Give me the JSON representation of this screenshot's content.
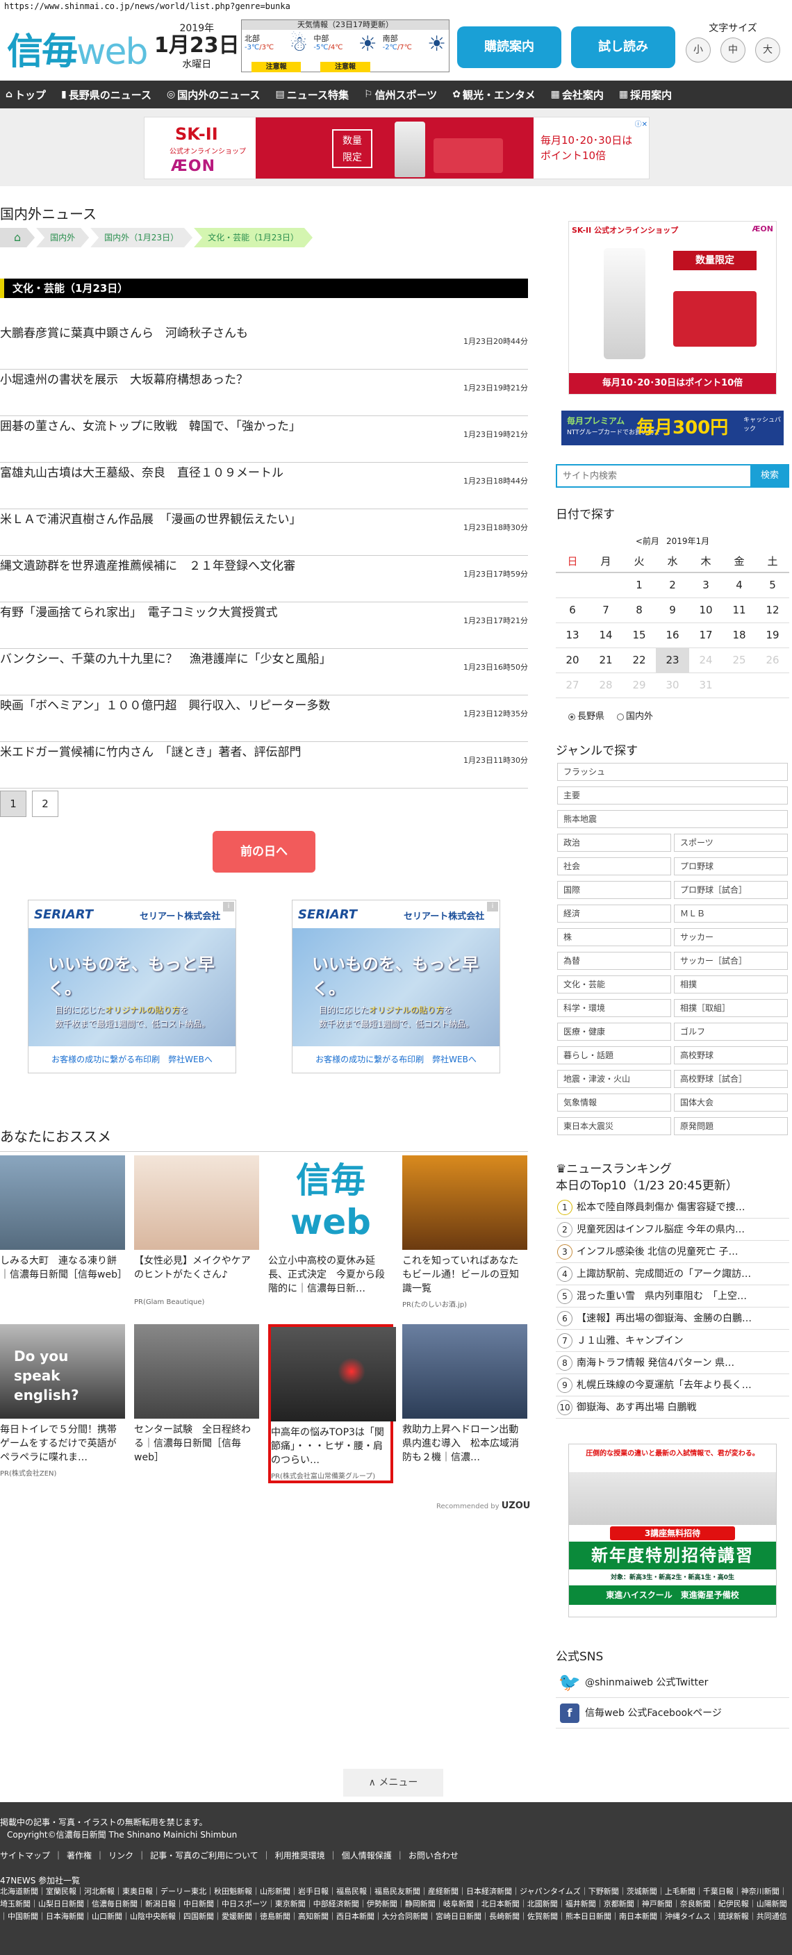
{
  "url": "https://www.shinmai.co.jp/news/world/list.php?genre=bunka",
  "header": {
    "logo_main": "信毎",
    "logo_web": "web",
    "year": "2019年",
    "monthday": "1月23日",
    "weekday": "水曜日",
    "weather": {
      "title": "天気情報（23日17時更新）",
      "regions": [
        {
          "name": "北部",
          "lo": "-3℃",
          "hi": "/3℃",
          "icon": "snow-cloud-icon",
          "glyph": "☃",
          "warning": "注意報"
        },
        {
          "name": "中部",
          "lo": "-5℃",
          "hi": "/4℃",
          "icon": "sun-icon",
          "glyph": "☀",
          "warning": "注意報"
        },
        {
          "name": "南部",
          "lo": "-2℃",
          "hi": "/7℃",
          "icon": "sun-icon",
          "glyph": "☀",
          "warning": ""
        }
      ]
    },
    "btn_subscribe": "購読案内",
    "btn_trial": "試し読み",
    "font_size_label": "文字サイズ",
    "font_sizes": [
      "小",
      "中",
      "大"
    ]
  },
  "nav": [
    {
      "icon": "home-icon",
      "glyph": "⌂",
      "label": "トップ"
    },
    {
      "icon": "pin-icon",
      "glyph": "▮",
      "label": "長野県のニュース"
    },
    {
      "icon": "globe-icon",
      "glyph": "◎",
      "label": "国内外のニュース"
    },
    {
      "icon": "doc-icon",
      "glyph": "▤",
      "label": "ニュース特集"
    },
    {
      "icon": "sports-icon",
      "glyph": "⚐",
      "label": "信州スポーツ"
    },
    {
      "icon": "tourism-icon",
      "glyph": "✿",
      "label": "観光・エンタメ"
    },
    {
      "icon": "company-icon",
      "glyph": "▦",
      "label": "会社案内"
    },
    {
      "icon": "recruit-icon",
      "glyph": "▦",
      "label": "採用案内"
    }
  ],
  "top_ad": {
    "brand": "SK-II",
    "sub": "公式オンラインショップ",
    "store": "ÆON",
    "badge": "数量\n限定",
    "right_line1": "毎月10･20･30日は",
    "right_line2": "ポイント10倍"
  },
  "main": {
    "section_title": "国内外ニュース",
    "breadcrumb": [
      "国内外",
      "国内外（1月23日）",
      "文化・芸能（1月23日）"
    ],
    "category": "文化・芸能（1月23日）",
    "news": [
      {
        "title": "大鵬春彦賞に葉真中顕さんら　河崎秋子さんも",
        "time": "1月23日20時44分"
      },
      {
        "title": "小堀遠州の書状を展示　大坂幕府構想あった？",
        "time": "1月23日19時21分"
      },
      {
        "title": "囲碁の菫さん、女流トップに敗戦　韓国で、「強かった」",
        "time": "1月23日19時21分"
      },
      {
        "title": "富雄丸山古墳は大王墓級、奈良　直径１０９メートル",
        "time": "1月23日18時44分"
      },
      {
        "title": "米ＬＡで浦沢直樹さん作品展　「漫画の世界観伝えたい」",
        "time": "1月23日18時30分"
      },
      {
        "title": "縄文遺跡群を世界遺産推薦候補に　２１年登録へ文化審",
        "time": "1月23日17時59分"
      },
      {
        "title": "有野「漫画捨てられ家出」　電子コミック大賞授賞式",
        "time": "1月23日17時21分"
      },
      {
        "title": "バンクシー、千葉の九十九里に？　漁港護岸に「少女と風船」",
        "time": "1月23日16時50分"
      },
      {
        "title": "映画「ボヘミアン」１００億円超　興行収入、リピーター多数",
        "time": "1月23日12時35分"
      },
      {
        "title": "米エドガー賞候補に竹内さん　「謎とき」著者、評伝部門",
        "time": "1月23日11時30分"
      }
    ],
    "pages": [
      "1",
      "2"
    ],
    "prev_day": "前の日へ",
    "seriart_ad": {
      "logo": "SERIART",
      "company": "セリアート株式会社",
      "headline": "いいものを、もっと早く。",
      "line1a": "目的に応じた",
      "line1b": "オリジナルの貼り方",
      "line1c": "を",
      "line2a": "数千枚まで最短",
      "line2b": "1週間で、低コスト納品。",
      "footer": "お客様の成功に繋がる布印刷　弊社WEBへ",
      "info": "i"
    },
    "recommend_title": "あなたにおススメ",
    "recommend": [
      {
        "caption": "しみる大町　連なる凍り餅｜信濃毎日新聞［信毎web］",
        "pr": ""
      },
      {
        "caption": "【女性必見】メイクやケアのヒントがたくさん♪",
        "pr": "PR(Glam Beautique)"
      },
      {
        "caption": "公立小中高校の夏休み延長、正式決定　今夏から段階的に｜信濃毎日新…",
        "pr": ""
      },
      {
        "caption": "これを知っていればあなたもビール通！ビールの豆知識一覧",
        "pr": "PR(たのしいお酒.jp)"
      },
      {
        "caption": "毎日トイレで５分間！携帯ゲームをするだけで英語がペラペラに喋れま…",
        "pr": "PR(株式会社ZEN)"
      },
      {
        "caption": "センター試験　全日程終わる｜信濃毎日新聞［信毎web］",
        "pr": ""
      },
      {
        "caption": "中高年の悩みTOP3は「関節痛」・・・ヒザ・腰・肩のつらい…",
        "pr": "PR(株式会社富山常備薬グループ)"
      },
      {
        "caption": "救助力上昇へドローン出動　県内進む導入　松本広域消防も２機｜信濃…",
        "pr": ""
      }
    ],
    "english_text": "Do you speak english?",
    "recommend_by": "Recommended by",
    "recommend_brand": "UZOU"
  },
  "side": {
    "skii_bar": "SK-II 公式オンラインショップ",
    "skii_store": "ÆON",
    "skii_limited": "数量限定",
    "skii_bottom": "毎月10･20･30日はポイント10倍",
    "ntt_l1": "毎月プレミアム",
    "ntt_l2": "NTTグループカードでお買い物で",
    "ntt_center": "毎月300円",
    "ntt_right": "キャッシュバック",
    "search_placeholder": "サイト内検索",
    "search_btn": "検索",
    "date_title": "日付で探す",
    "cal_prev": "<前月",
    "cal_ym": "2019年1月",
    "cal_head": [
      "日",
      "月",
      "火",
      "水",
      "木",
      "金",
      "土"
    ],
    "cal_rows": [
      [
        "",
        "",
        "1",
        "2",
        "3",
        "4",
        "5"
      ],
      [
        "6",
        "7",
        "8",
        "9",
        "10",
        "11",
        "12"
      ],
      [
        "13",
        "14",
        "15",
        "16",
        "17",
        "18",
        "19"
      ],
      [
        "20",
        "21",
        "22",
        "23",
        "24",
        "25",
        "26"
      ],
      [
        "27",
        "28",
        "29",
        "30",
        "31",
        "",
        ""
      ]
    ],
    "cal_radio": [
      "長野県",
      "国内外"
    ],
    "genre_title": "ジャンルで探す",
    "genre_full": [
      "フラッシュ",
      "主要",
      "熊本地震"
    ],
    "genre_pairs": [
      [
        "政治",
        "スポーツ"
      ],
      [
        "社会",
        "プロ野球"
      ],
      [
        "国際",
        "プロ野球［試合］"
      ],
      [
        "経済",
        "ＭＬＢ"
      ],
      [
        "株",
        "サッカー"
      ],
      [
        "為替",
        "サッカー［試合］"
      ],
      [
        "文化・芸能",
        "相撲"
      ],
      [
        "科学・環境",
        "相撲［取組］"
      ],
      [
        "医療・健康",
        "ゴルフ"
      ],
      [
        "暮らし・話題",
        "高校野球"
      ],
      [
        "地震・津波・火山",
        "高校野球［試合］"
      ],
      [
        "気象情報",
        "国体大会"
      ],
      [
        "東日本大震災",
        "原発問題"
      ]
    ],
    "rank_title": "ニュースランキング",
    "rank_sub": "本日のTop10（1/23 20:45更新）",
    "rank": [
      "松本で陸自隊員刺傷か 傷害容疑で捜…",
      "児童死因はインフル脳症 今年の県内…",
      "インフル感染後 北信の児童死亡 子…",
      "上諏訪駅前、完成間近の「アーク諏訪…",
      "混った重い雪　県内列車阻む　「上空…",
      "【速報】再出場の御嶽海、金勝の白鵬…",
      "Ｊ１山雅、キャンプイン",
      "南海トラフ情報 発信4パターン 県…",
      "札幌丘珠線の今夏運航「去年より長く…",
      "御嶽海、あす再出場 白鵬戦"
    ],
    "juku_top": "圧倒的な授業の違いと最新の入試情報で、君が変わる。",
    "juku_free": "3講座無料招待",
    "juku_main": "新年度特別招待講習",
    "juku_small": "対象：新高3生・新高2生・新高1生・高0生",
    "juku_brand": "東進ハイスクール　東進衛星予備校",
    "sns_title": "公式SNS",
    "sns": [
      {
        "icon": "twitter-icon",
        "glyph": "🐦",
        "label": "@shinmaiweb 公式Twitter"
      },
      {
        "icon": "facebook-icon",
        "glyph": "f",
        "label": "信毎web 公式Facebookページ"
      }
    ]
  },
  "menu_btn": "∧ メニュー",
  "footer": {
    "notice": "掲載中の記事・写真・イラストの無断転用を禁じます。",
    "copyright": "Copyright©信濃毎日新聞 The Shinano Mainichi Shimbun",
    "links": [
      "サイトマップ",
      "｜",
      "著作権",
      "｜",
      "リンク",
      "｜",
      "記事・写真のご利用について",
      "｜",
      "利用推奨環境",
      "｜",
      "個人情報保護",
      "｜",
      "お問い合わせ"
    ],
    "news47": "47NEWS 参加社一覧",
    "papers": "北海道新聞｜室蘭民報｜河北新報｜東奥日報｜デーリー東北｜秋田魁新報｜山形新聞｜岩手日報｜福島民報｜福島民友新聞｜産経新聞｜日本経済新聞｜ジャパンタイムズ｜下野新聞｜茨城新聞｜上毛新聞｜千葉日報｜神奈川新聞｜埼玉新聞｜山梨日日新聞｜信濃毎日新聞｜新潟日報｜中日新聞｜中日スポーツ｜東京新聞｜中部経済新聞｜伊勢新聞｜静岡新聞｜岐阜新聞｜北日本新聞｜北國新聞｜福井新聞｜京都新聞｜神戸新聞｜奈良新聞｜紀伊民報｜山陽新聞｜中国新聞｜日本海新聞｜山口新聞｜山陰中央新報｜四国新聞｜愛媛新聞｜徳島新聞｜高知新聞｜西日本新聞｜大分合同新聞｜宮崎日日新聞｜長崎新聞｜佐賀新聞｜熊本日日新聞｜南日本新聞｜沖縄タイムス｜琉球新報｜共同通信"
  }
}
